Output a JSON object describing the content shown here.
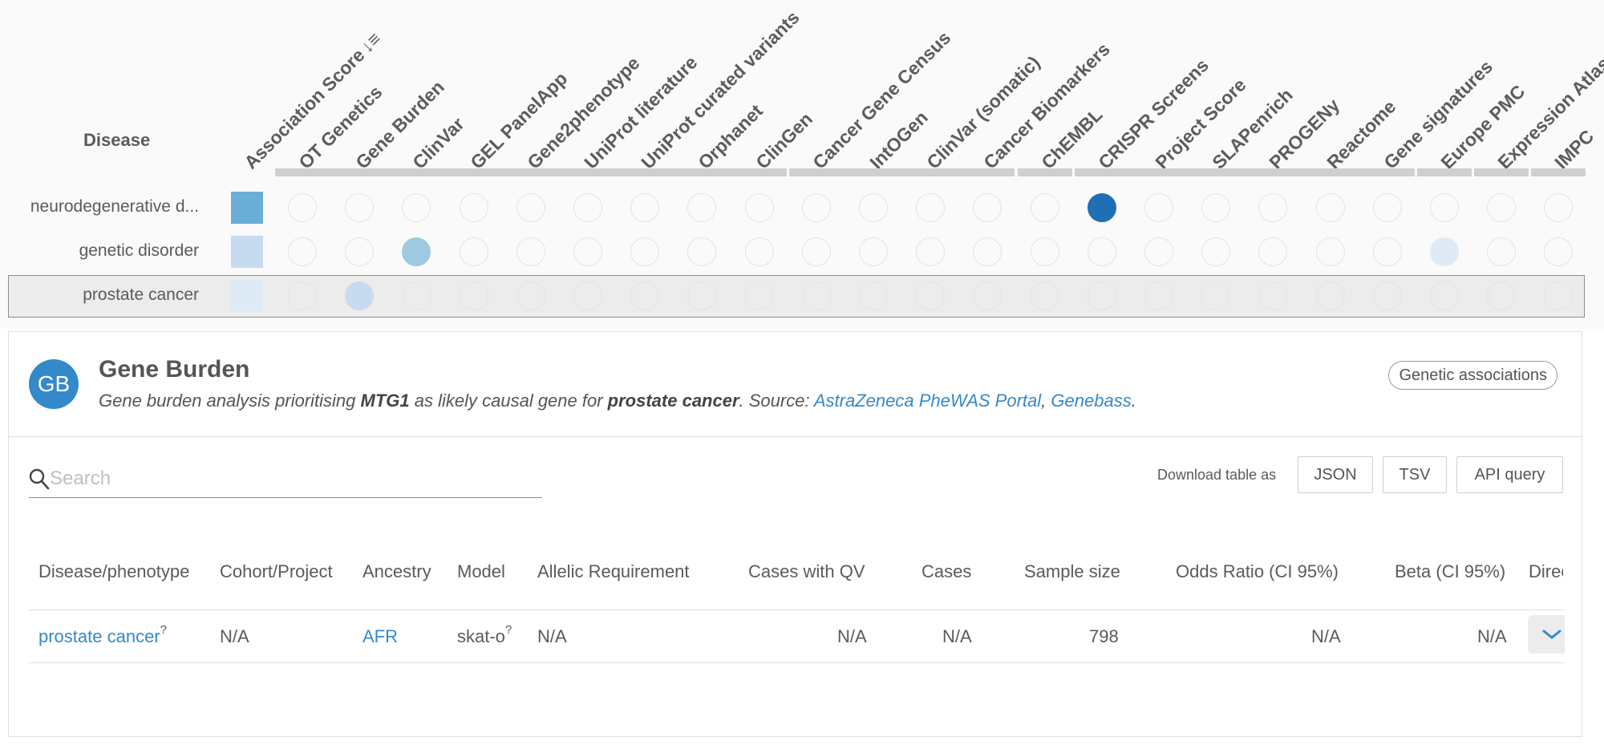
{
  "matrix": {
    "disease_header": "Disease",
    "columns": [
      {
        "label": "Association Score",
        "sort_icon": "sort-desc-icon",
        "sort_glyph": "↓≡"
      },
      {
        "label": "OT Genetics"
      },
      {
        "label": "Gene Burden"
      },
      {
        "label": "ClinVar"
      },
      {
        "label": "GEL PanelApp"
      },
      {
        "label": "Gene2phenotype"
      },
      {
        "label": "UniProt literature"
      },
      {
        "label": "UniProt curated variants"
      },
      {
        "label": "Orphanet"
      },
      {
        "label": "ClinGen"
      },
      {
        "label": "Cancer Gene Census"
      },
      {
        "label": "IntOGen"
      },
      {
        "label": "ClinVar (somatic)"
      },
      {
        "label": "Cancer Biomarkers"
      },
      {
        "label": "ChEMBL"
      },
      {
        "label": "CRISPR Screens"
      },
      {
        "label": "Project Score"
      },
      {
        "label": "SLAPenrich"
      },
      {
        "label": "PROGENy"
      },
      {
        "label": "Reactome"
      },
      {
        "label": "Gene signatures"
      },
      {
        "label": "Europe PMC"
      },
      {
        "label": "Expression Atlas"
      },
      {
        "label": "IMPC"
      }
    ],
    "rows": [
      {
        "disease": "neurodegenerative d...",
        "score_color": "#6aaed6",
        "cells": {
          "15": "#1f6fb4"
        }
      },
      {
        "disease": "genetic disorder",
        "score_color": "#c6dbef",
        "cells": {
          "3": "#9ecae1",
          "21": "#deebf7"
        }
      },
      {
        "disease": "prostate cancer",
        "score_color": "#deebf7",
        "cells": {
          "2": "#c6dbef"
        },
        "selected": true,
        "selected_cell": 2
      }
    ]
  },
  "panel": {
    "avatar": "GB",
    "title": "Gene Burden",
    "desc_prefix": "Gene burden analysis prioritising ",
    "gene": "MTG1",
    "desc_mid": " as likely causal gene for ",
    "disease": "prostate cancer",
    "desc_source": ". Source: ",
    "source1": "AstraZeneca PheWAS Portal",
    "separator": ", ",
    "source2": "Genebass",
    "end": ".",
    "chip": "Genetic associations"
  },
  "search": {
    "placeholder": "Search"
  },
  "download": {
    "label": "Download table as",
    "json": "JSON",
    "tsv": "TSV",
    "api": "API query"
  },
  "table": {
    "headers": [
      "Disease/phenotype",
      "Cohort/Project",
      "Ancestry",
      "Model",
      "Allelic Requirement",
      "Cases with QV",
      "Cases",
      "Sample size",
      "Odds Ratio (CI 95%)",
      "Beta (CI 95%)",
      "Direc"
    ],
    "row": {
      "disease": "prostate cancer",
      "disease_sup": "?",
      "cohort": "N/A",
      "ancestry": "AFR",
      "model": "skat-o",
      "model_sup": "?",
      "allelic": "N/A",
      "cases_qv": "N/A",
      "cases": "N/A",
      "sample_size": "798",
      "odds_ratio": "N/A",
      "beta": "N/A"
    }
  },
  "colors": {
    "accent": "#3489ca"
  }
}
